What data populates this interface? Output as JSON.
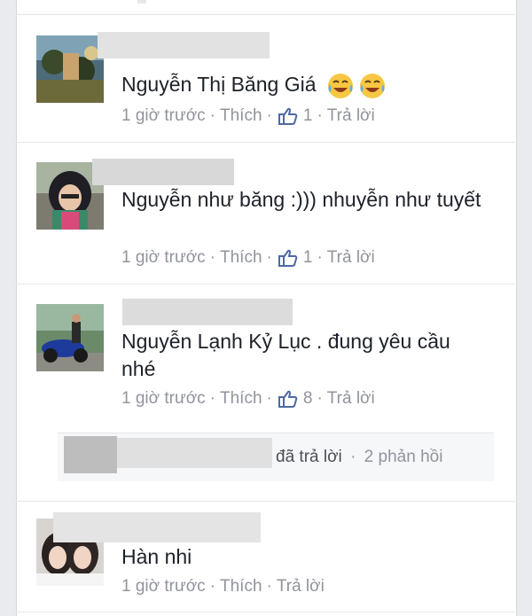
{
  "comments": [
    {
      "text": "Nguyễn Thị Băng Giá",
      "time": "1 giờ trước",
      "like_label": "Thích",
      "like_count": "1",
      "reply_label": "Trả lời"
    },
    {
      "text": "Nguyễn như băng :))) nhuyễn như tuyết",
      "time": "1 giờ trước",
      "like_label": "Thích",
      "like_count": "1",
      "reply_label": "Trả lời"
    },
    {
      "text": "Nguyễn Lạnh Kỷ Lục . đung yêu cầu nhé",
      "time": "1 giờ trước",
      "like_label": "Thích",
      "like_count": "8",
      "reply_label": "Trả lời"
    },
    {
      "text": "Hàn nhi",
      "time": "1 giờ trước",
      "like_label": "Thích",
      "reply_label": "Trả lời"
    }
  ],
  "reply_summary": {
    "action": "đã trả lời",
    "count": "2 phản hồi"
  },
  "separator_char": "·",
  "icons": {
    "like": "thumbs-up-icon",
    "emoji": "tears-of-joy-emoji"
  },
  "colors": {
    "meta": "#90949c",
    "like_icon": "#4e69a2",
    "text": "#1d2129"
  }
}
